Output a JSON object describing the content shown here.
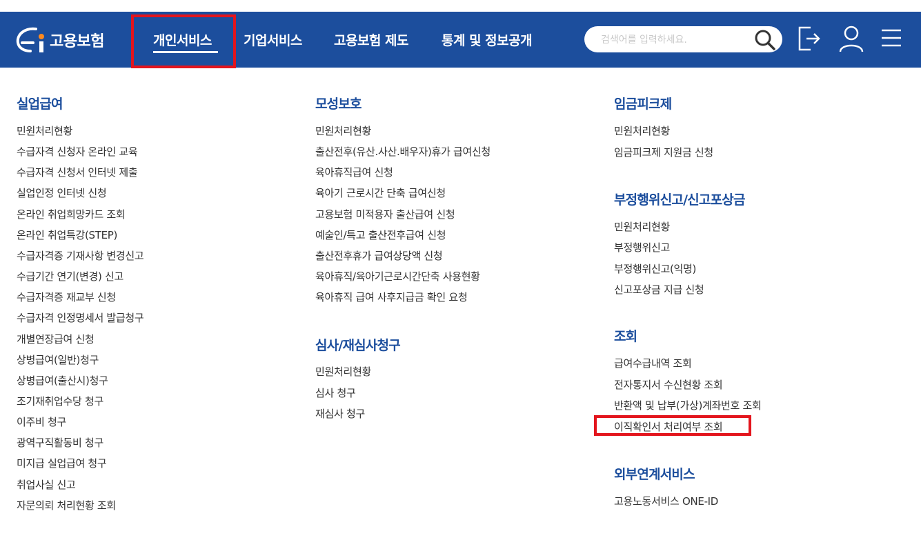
{
  "header": {
    "logo_text": "고용보험",
    "nav": [
      "개인서비스",
      "기업서비스",
      "고용보험 제도",
      "통계 및 정보공개"
    ],
    "search_placeholder": "검색어를 입력하세요.",
    "brand_color": "#1c4e9d",
    "highlight_color": "#e3151d"
  },
  "sections": {
    "unemployment": {
      "title": "실업급여",
      "links": [
        "민원처리현황",
        "수급자격 신청자 온라인 교육",
        "수급자격 신청서 인터넷 제출",
        "실업인정 인터넷 신청",
        "온라인 취업희망카드 조회",
        "온라인 취업특강(STEP)",
        "수급자격증 기재사항 변경신고",
        "수급기간 연기(변경) 신고",
        "수급자격증 재교부 신청",
        "수급자격 인정명세서 발급청구",
        "개별연장급여 신청",
        "상병급여(일반)청구",
        "상병급여(출산시)청구",
        "조기재취업수당 청구",
        "이주비 청구",
        "광역구직활동비 청구",
        "미지급 실업급여 청구",
        "취업사실 신고",
        "자문의뢰 처리현황 조회"
      ]
    },
    "maternity": {
      "title": "모성보호",
      "links": [
        "민원처리현황",
        "출산전후(유산.사산.배우자)휴가 급여신청",
        "육아휴직급여 신청",
        "육아기 근로시간 단축 급여신청",
        "고용보험 미적용자 출산급여 신청",
        "예술인/특고 출산전후급여 신청",
        "출산전후휴가 급여상당액 신청",
        "육아휴직/육아기근로시간단축 사용현황",
        "육아휴직 급여 사후지급금 확인 요청"
      ]
    },
    "review": {
      "title": "심사/재심사청구",
      "links": [
        "민원처리현황",
        "심사 청구",
        "재심사 청구"
      ]
    },
    "wagepeak": {
      "title": "임금피크제",
      "links": [
        "민원처리현황",
        "임금피크제 지원금 신청"
      ]
    },
    "fraud": {
      "title": "부정행위신고/신고포상금",
      "links": [
        "민원처리현황",
        "부정행위신고",
        "부정행위신고(익명)",
        "신고포상금 지급 신청"
      ]
    },
    "inquiry": {
      "title": "조회",
      "links": [
        "급여수급내역 조회",
        "전자통지서 수신현황 조회",
        "반환액 및 납부(가상)계좌번호 조회",
        "이직확인서 처리여부 조회"
      ]
    },
    "external": {
      "title": "외부연계서비스",
      "links": [
        "고용노동서비스 ONE-ID"
      ]
    }
  }
}
